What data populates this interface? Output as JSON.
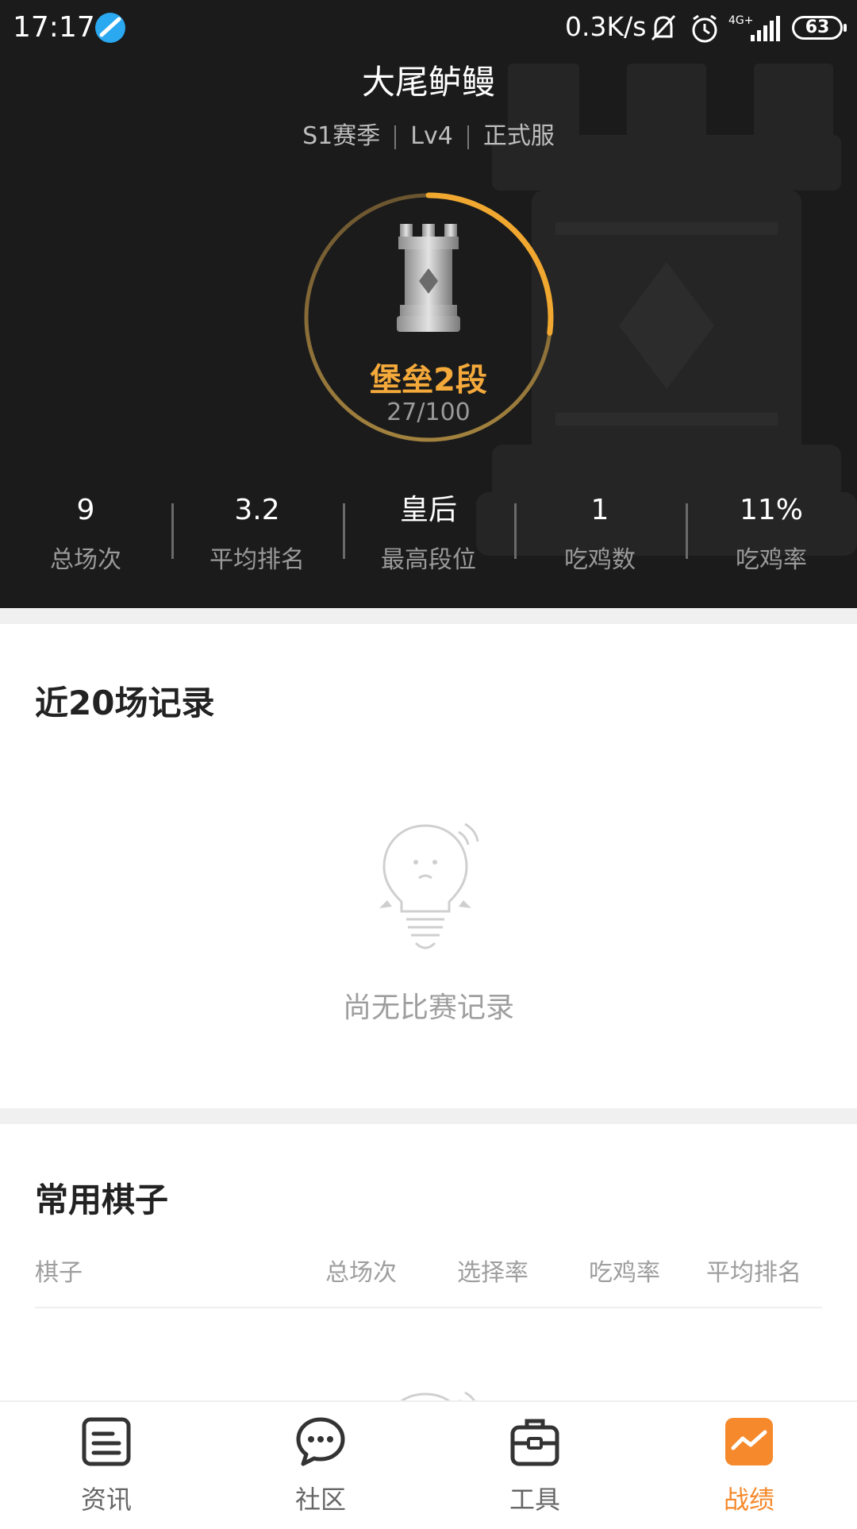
{
  "status_bar": {
    "time": "17:17",
    "network_speed": "0.3K/s",
    "signal": "4G+",
    "battery": "63"
  },
  "profile": {
    "nickname": "大尾鲈鳗",
    "season": "S1赛季",
    "level": "Lv4",
    "server": "正式服"
  },
  "rank": {
    "name": "堡垒2段",
    "progress_text": "27/100",
    "progress_fraction": 0.27,
    "accent_color": "#f4a93a"
  },
  "stats": [
    {
      "value": "9",
      "label": "总场次"
    },
    {
      "value": "3.2",
      "label": "平均排名"
    },
    {
      "value": "皇后",
      "label": "最高段位"
    },
    {
      "value": "1",
      "label": "吃鸡数"
    },
    {
      "value": "11%",
      "label": "吃鸡率"
    }
  ],
  "recent_records": {
    "title": "近20场记录",
    "empty_text": "尚无比赛记录",
    "empty_icon": "lightbulb-icon"
  },
  "common_pieces": {
    "title": "常用棋子",
    "columns": [
      "棋子",
      "总场次",
      "选择率",
      "吃鸡率",
      "平均排名"
    ]
  },
  "bottom_nav": [
    {
      "label": "资讯",
      "icon": "news-icon",
      "active": false
    },
    {
      "label": "社区",
      "icon": "chat-bubble-icon",
      "active": false
    },
    {
      "label": "工具",
      "icon": "toolbox-icon",
      "active": false
    },
    {
      "label": "战绩",
      "icon": "stats-chart-icon",
      "active": true
    }
  ],
  "colors": {
    "active_tab": "#f5892b",
    "header_bg": "#1b1b1b"
  }
}
